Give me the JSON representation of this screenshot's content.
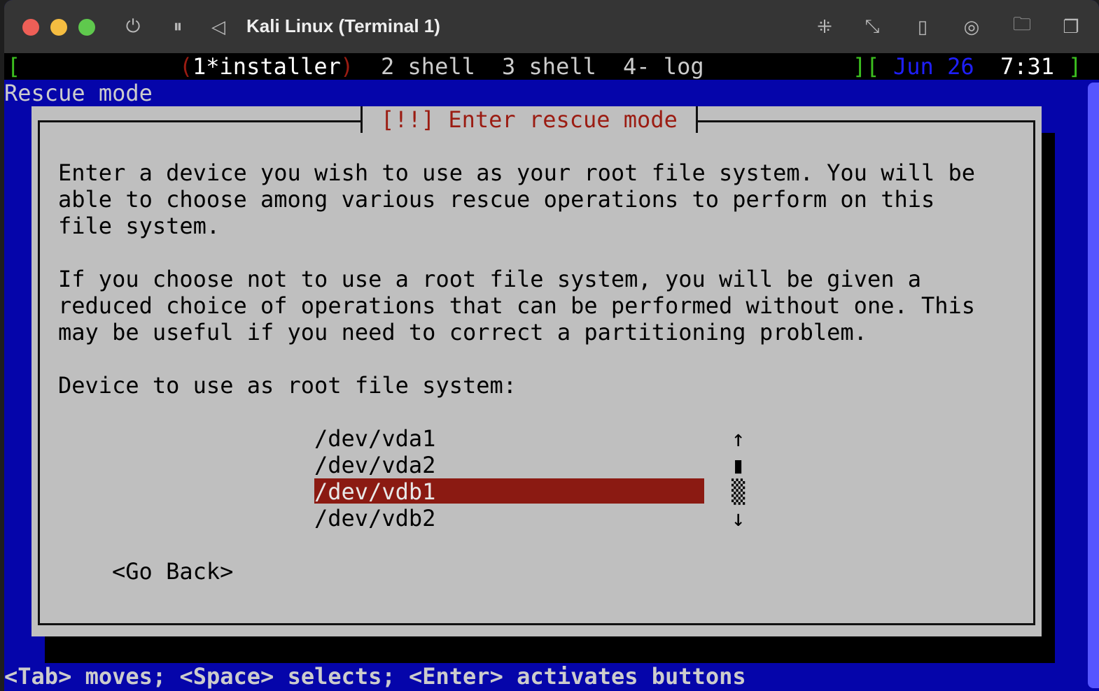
{
  "window": {
    "title": "Kali Linux (Terminal 1)"
  },
  "tmux": {
    "open": "[",
    "win1_open": "(",
    "win1": "1*installer",
    "win1_close": ")",
    "win2": "2 shell",
    "win3": "3 shell",
    "win4": "4- log",
    "right_open": "][",
    "date": "Jun 26",
    "time": "7:31",
    "right_close": "]"
  },
  "screen": {
    "heading": "Rescue mode"
  },
  "dialog": {
    "title": "[!!] Enter rescue mode",
    "para1": [
      "Enter a device you wish to use as your root file system. You will be",
      "able to choose among various rescue operations to perform on this",
      "file system."
    ],
    "para2": [
      "If you choose not to use a root file system, you will be given a",
      "reduced choice of operations that can be performed without one. This",
      "may be useful if you need to correct a partitioning problem."
    ],
    "prompt": "Device to use as root file system:",
    "options": [
      "/dev/vda1",
      "/dev/vda2",
      "/dev/vdb1",
      "/dev/vdb2"
    ],
    "selected": "/dev/vdb1",
    "scroll": {
      "up": "↑",
      "thumb": "▮",
      "track": "▒",
      "down": "↓"
    },
    "go_back": "<Go Back>"
  },
  "help": "<Tab> moves; <Space> selects; <Enter> activates buttons",
  "colors": {
    "background": "#0505aa",
    "dialog": "#bfbfbf",
    "highlight": "#8b1a12",
    "title": "#9b1c12"
  }
}
